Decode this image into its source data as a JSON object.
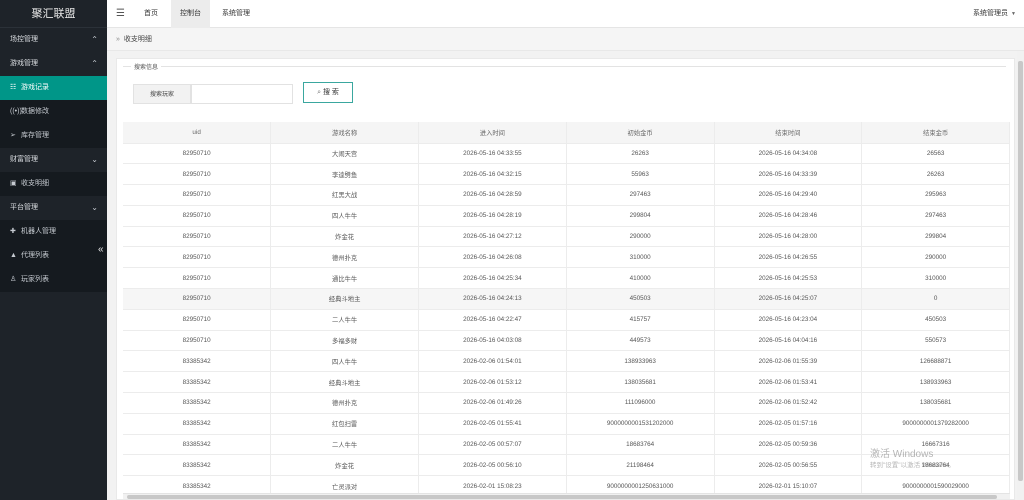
{
  "app": {
    "title": "聚汇联盟"
  },
  "sidebar": {
    "items": [
      {
        "type": "group",
        "label": "场控管理",
        "icon": "chevron-up-icon",
        "glyph": "⌃"
      },
      {
        "type": "group",
        "label": "游戏管理",
        "icon": "chevron-up-icon",
        "glyph": "⌃"
      },
      {
        "type": "item",
        "label": "游戏记录",
        "icon": "grid-icon",
        "glyph": "☷",
        "active": true
      },
      {
        "type": "item",
        "label": "数据修改",
        "icon": "wifi-icon",
        "glyph": "((•))"
      },
      {
        "type": "item",
        "label": "库存管理",
        "icon": "send-icon",
        "glyph": "➢"
      },
      {
        "type": "group",
        "label": "财富管理",
        "icon": "chevron-down-icon",
        "glyph": "⌄"
      },
      {
        "type": "item",
        "label": "收支明细",
        "icon": "receipt-icon",
        "glyph": "▣"
      },
      {
        "type": "group",
        "label": "平台管理",
        "icon": "chevron-down-icon",
        "glyph": "⌄"
      },
      {
        "type": "item",
        "label": "机器人管理",
        "icon": "android-icon",
        "glyph": "✚"
      },
      {
        "type": "item",
        "label": "代理列表",
        "icon": "user-icon",
        "glyph": "▲"
      },
      {
        "type": "item",
        "label": "玩家列表",
        "icon": "user-search-icon",
        "glyph": "♙"
      }
    ],
    "collapse_glyph": "«"
  },
  "topbar": {
    "menu_glyph": "☰",
    "tabs": [
      {
        "label": "首页"
      },
      {
        "label": "控制台",
        "active": true
      },
      {
        "label": "系统管理"
      }
    ],
    "user": "系统管理员",
    "user_caret": "▼"
  },
  "breadcrumb": {
    "sep": "»",
    "current": "收支明细"
  },
  "search": {
    "legend": "搜索信息",
    "label": "搜索玩家",
    "input_value": "",
    "button_label": "搜 索",
    "button_glyph": "⌕"
  },
  "table": {
    "columns": [
      "uid",
      "游戏名称",
      "进入时间",
      "初始金币",
      "结束时间",
      "结束金币"
    ],
    "rows": [
      [
        "82950710",
        "大闹天宫",
        "2026-05-16 04:33:55",
        "26263",
        "2026-05-16 04:34:08",
        "26563"
      ],
      [
        "82950710",
        "李逵劈鱼",
        "2026-05-16 04:32:15",
        "55963",
        "2026-05-16 04:33:39",
        "26263"
      ],
      [
        "82950710",
        "红黑大战",
        "2026-05-16 04:28:59",
        "297463",
        "2026-05-16 04:29:40",
        "295963"
      ],
      [
        "82950710",
        "四人牛牛",
        "2026-05-16 04:28:19",
        "299804",
        "2026-05-16 04:28:46",
        "297463"
      ],
      [
        "82950710",
        "炸金花",
        "2026-05-16 04:27:12",
        "290000",
        "2026-05-16 04:28:00",
        "299804"
      ],
      [
        "82950710",
        "德州扑克",
        "2026-05-16 04:26:08",
        "310000",
        "2026-05-16 04:26:55",
        "290000"
      ],
      [
        "82950710",
        "通比牛牛",
        "2026-05-16 04:25:34",
        "410000",
        "2026-05-16 04:25:53",
        "310000"
      ],
      [
        "82950710",
        "经典斗地主",
        "2026-05-16 04:24:13",
        "450503",
        "2026-05-16 04:25:07",
        "0"
      ],
      [
        "82950710",
        "二人牛牛",
        "2026-05-16 04:22:47",
        "415757",
        "2026-05-16 04:23:04",
        "450503"
      ],
      [
        "82950710",
        "多福多财",
        "2026-05-16 04:03:08",
        "449573",
        "2026-05-16 04:04:16",
        "550573"
      ],
      [
        "83385342",
        "四人牛牛",
        "2026-02-06 01:54:01",
        "138933963",
        "2026-02-06 01:55:39",
        "126688871"
      ],
      [
        "83385342",
        "经典斗地主",
        "2026-02-06 01:53:12",
        "138035681",
        "2026-02-06 01:53:41",
        "138933963"
      ],
      [
        "83385342",
        "德州扑克",
        "2026-02-06 01:49:26",
        "111096000",
        "2026-02-06 01:52:42",
        "138035681"
      ],
      [
        "83385342",
        "红包扫雷",
        "2026-02-05 01:55:41",
        "9000000001531202000",
        "2026-02-05 01:57:16",
        "9000000001379282000"
      ],
      [
        "83385342",
        "二人牛牛",
        "2026-02-05 00:57:07",
        "18683764",
        "2026-02-05 00:59:36",
        "16667316"
      ],
      [
        "83385342",
        "炸金花",
        "2026-02-05 00:56:10",
        "21198464",
        "2026-02-05 00:56:55",
        "18683764"
      ],
      [
        "83385342",
        "亡灵派对",
        "2026-02-01 15:08:23",
        "9000000001250631000",
        "2026-02-01 15:10:07",
        "9000000001590029000"
      ]
    ],
    "highlight_row": 7
  },
  "watermark": {
    "line1": "激活 Windows",
    "line2": "转到\"设置\"以激活 Windows。"
  }
}
